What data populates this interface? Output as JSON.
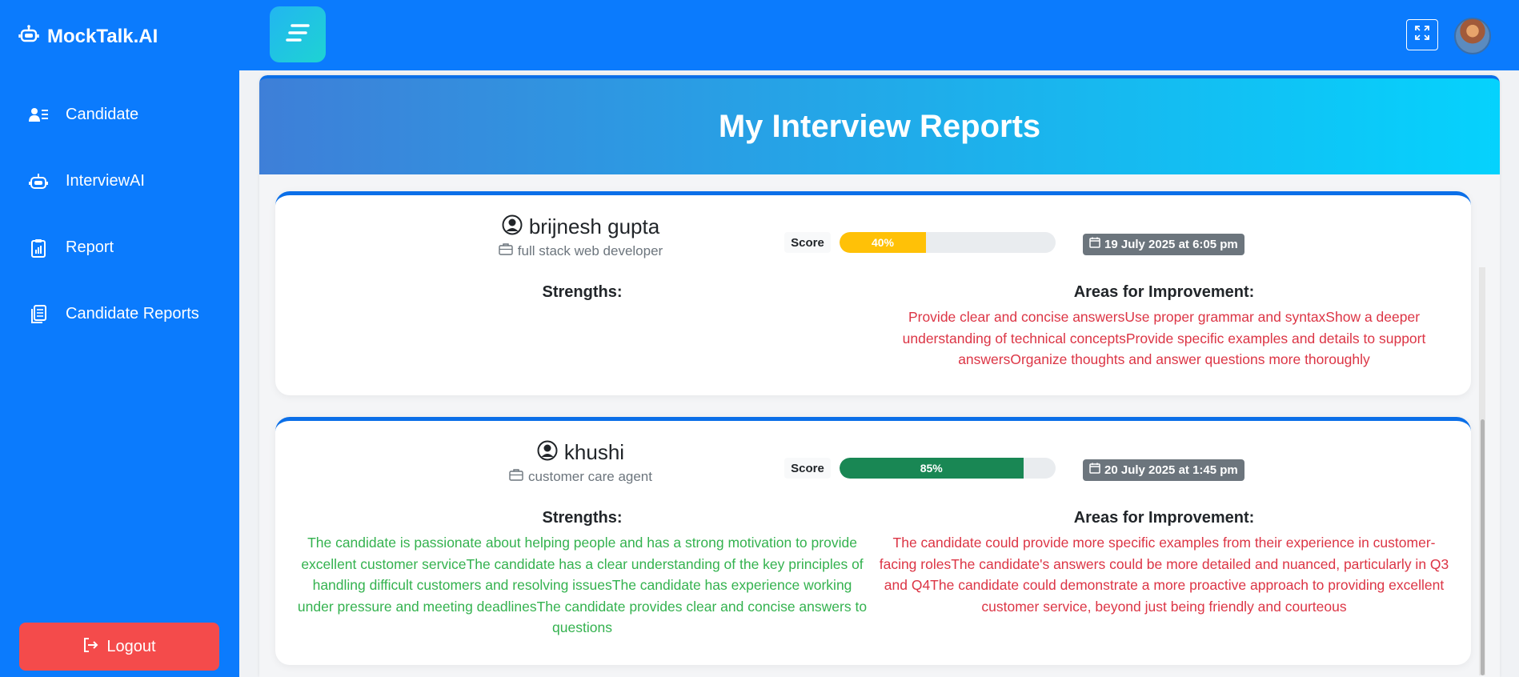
{
  "app": {
    "name": "MockTalk.AI"
  },
  "sidebar": {
    "items": [
      {
        "label": "Candidate",
        "icon": "candidate-icon"
      },
      {
        "label": "InterviewAI",
        "icon": "robot-icon"
      },
      {
        "label": "Report",
        "icon": "report-icon"
      },
      {
        "label": "Candidate Reports",
        "icon": "documents-icon"
      }
    ],
    "logout_label": "Logout"
  },
  "header": {
    "menu_icon": "hamburger-icon",
    "fullscreen_icon": "fullscreen-icon"
  },
  "page": {
    "title": "My Interview Reports"
  },
  "reports": [
    {
      "name": "brijnesh gupta",
      "role": "full stack web developer",
      "score_label": "Score",
      "score": 40,
      "score_text": "40%",
      "score_color": "#ffc107",
      "date": "19 July 2025 at 6:05 pm",
      "strengths_title": "Strengths:",
      "strengths": "",
      "improvements_title": "Areas for Improvement:",
      "improvements": "Provide clear and concise answersUse proper grammar and syntaxShow a deeper understanding of technical conceptsProvide specific examples and details to support answersOrganize thoughts and answer questions more thoroughly"
    },
    {
      "name": "khushi",
      "role": "customer care agent",
      "score_label": "Score",
      "score": 85,
      "score_text": "85%",
      "score_color": "#198754",
      "date": "20 July 2025 at 1:45 pm",
      "strengths_title": "Strengths:",
      "strengths": "The candidate is passionate about helping people and has a strong motivation to provide excellent customer serviceThe candidate has a clear understanding of the key principles of handling difficult customers and resolving issuesThe candidate has experience working under pressure and meeting deadlinesThe candidate provides clear and concise answers to questions",
      "improvements_title": "Areas for Improvement:",
      "improvements": "The candidate could provide more specific examples from their experience in customer-facing rolesThe candidate's answers could be more detailed and nuanced, particularly in Q3 and Q4The candidate could demonstrate a more proactive approach to providing excellent customer service, beyond just being friendly and courteous"
    }
  ]
}
